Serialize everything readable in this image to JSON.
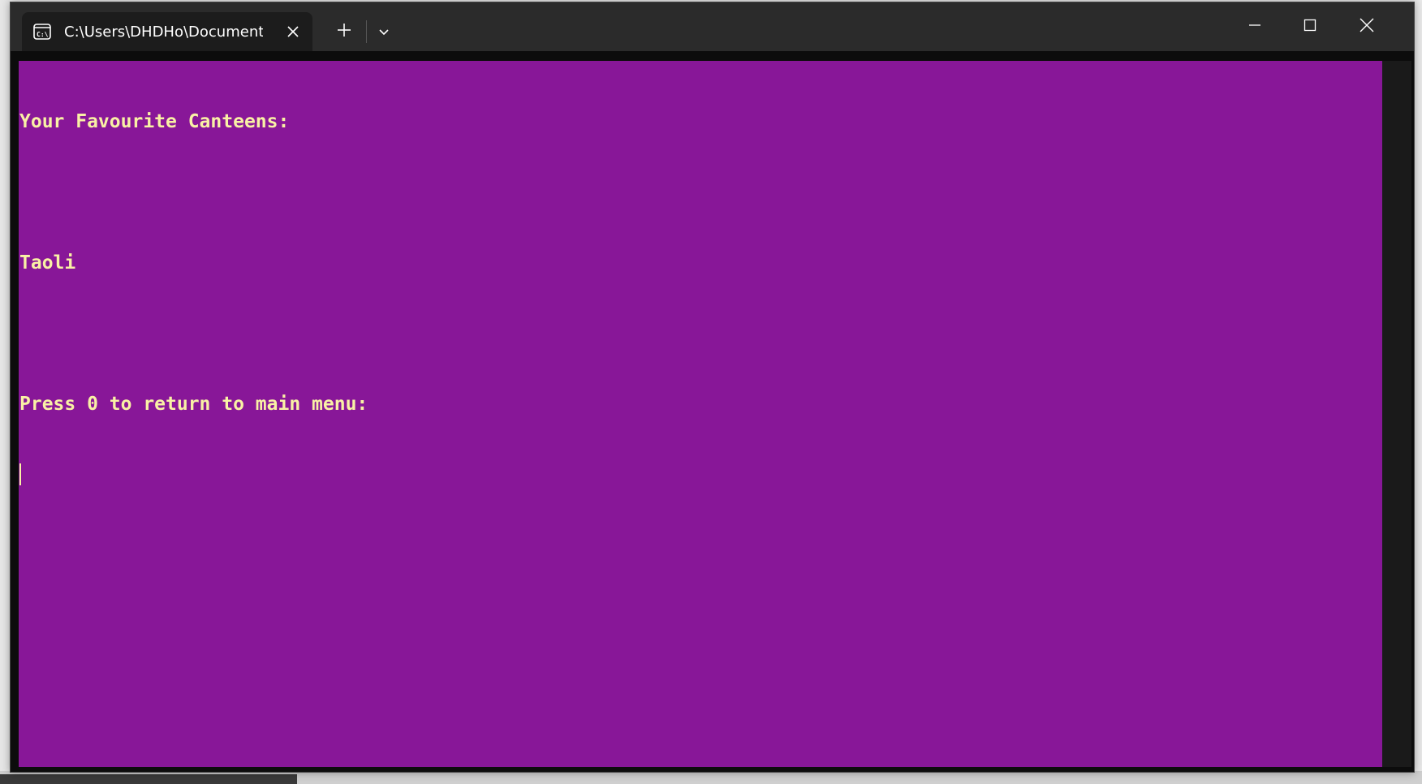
{
  "window": {
    "tab_title": "C:\\Users\\DHDHo\\Documents\\",
    "tab_icon": "console-icon"
  },
  "terminal": {
    "background_color": "#881798",
    "text_color": "#f9f1a5",
    "lines": [
      "Your Favourite Canteens:",
      "",
      "Taoli",
      "",
      "Press 0 to return to main menu:"
    ]
  }
}
